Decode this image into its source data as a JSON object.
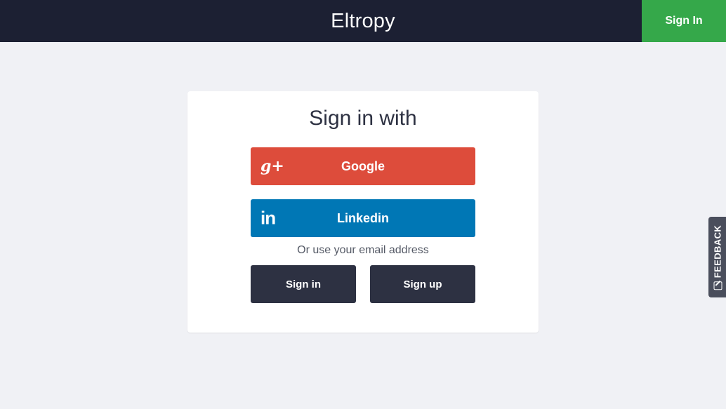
{
  "header": {
    "brand": "Eltropy",
    "signin_label": "Sign In"
  },
  "card": {
    "title": "Sign in with",
    "google": {
      "icon": "google-plus-icon",
      "glyph": "g+",
      "label": "Google"
    },
    "linkedin": {
      "icon": "linkedin-icon",
      "glyph": "in",
      "label": "Linkedin"
    },
    "or_text": "Or use your email address",
    "signin_label": "Sign in",
    "signup_label": "Sign up"
  },
  "feedback": {
    "icon": "edit-icon",
    "label": "FEEDBACK"
  },
  "colors": {
    "header_bg": "#1c2033",
    "signin_accent": "#35a84a",
    "google": "#dd4c3b",
    "linkedin": "#0077b5",
    "dark_button": "#2d3142",
    "page_bg": "#f0f1f5"
  }
}
